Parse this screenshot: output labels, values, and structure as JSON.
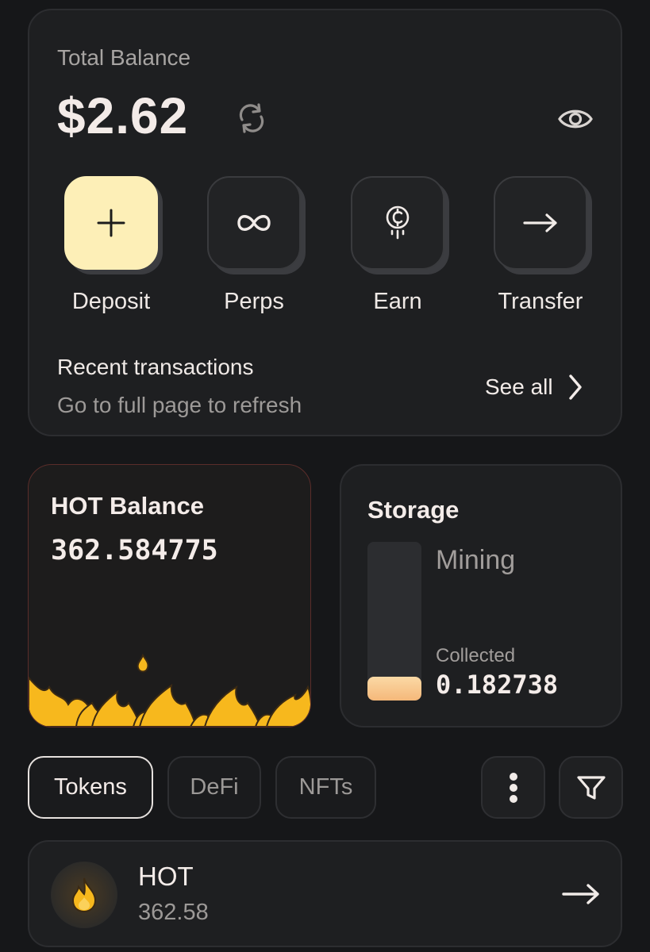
{
  "balance": {
    "title": "Total Balance",
    "amount": "$2.62",
    "icons": {
      "refresh": "refresh-icon",
      "visibility": "eye-icon"
    }
  },
  "actions": [
    {
      "label": "Deposit",
      "icon": "plus-icon",
      "highlight_color": "#fdefb7"
    },
    {
      "label": "Perps",
      "icon": "infinity-icon"
    },
    {
      "label": "Earn",
      "icon": "coin-icon"
    },
    {
      "label": "Transfer",
      "icon": "arrow-right-icon"
    }
  ],
  "recent": {
    "title": "Recent transactions",
    "subtitle": "Go to full page to refresh",
    "see_all": "See all"
  },
  "hot_card": {
    "title": "HOT Balance",
    "value": "362.584775"
  },
  "storage": {
    "title": "Storage",
    "status": "Mining",
    "collected_label": "Collected",
    "collected_value": "0.182738",
    "fill_fraction": 0.15
  },
  "tabs": [
    {
      "label": "Tokens",
      "active": true
    },
    {
      "label": "DeFi",
      "active": false
    },
    {
      "label": "NFTs",
      "active": false
    }
  ],
  "toolbar": {
    "more_icon": "more-vertical-icon",
    "filter_icon": "filter-icon"
  },
  "tokens": [
    {
      "name": "HOT",
      "amount": "362.58",
      "icon": "fire-icon"
    }
  ],
  "colors": {
    "background": "#161719",
    "card": "#1e1f21",
    "accent_yellow": "#fdefb7",
    "flame": "#f7b81d",
    "storage_fill": "#f5b87a"
  }
}
